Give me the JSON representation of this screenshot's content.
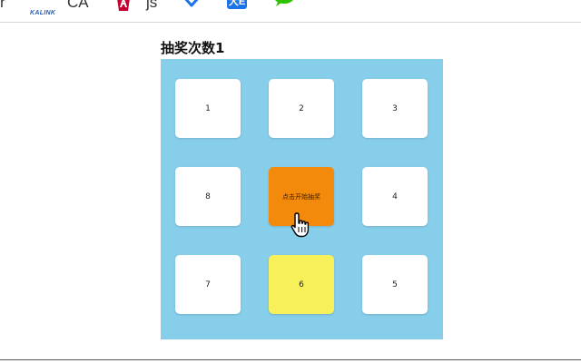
{
  "bookmarks": {
    "left_fragment": "r",
    "kalink_label": "KALINK",
    "ca_label": "CA",
    "js_label": "js",
    "blue_badge_label": "大E"
  },
  "page": {
    "title": "抽奖次数",
    "count": "1"
  },
  "board": {
    "cells": {
      "c1": "1",
      "c2": "2",
      "c3": "3",
      "c4": "4",
      "c5": "5",
      "c6": "6",
      "c7": "7",
      "c8": "8"
    },
    "start_label": "点击开始抽奖",
    "active_cell": "6"
  },
  "colors": {
    "board_bg": "#87ceeb",
    "cell_bg": "#ffffff",
    "start_bg": "#f48a0b",
    "active_bg": "#f7f05a"
  }
}
